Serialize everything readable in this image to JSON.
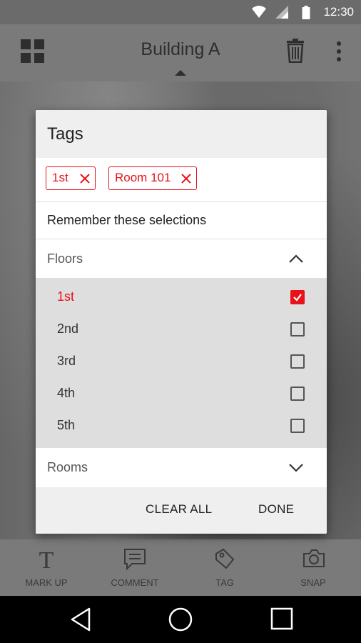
{
  "status_bar": {
    "time": "12:30",
    "icons": [
      "wifi-icon",
      "signal-icon",
      "battery-icon"
    ]
  },
  "app_bar": {
    "title": "Building A",
    "icons": [
      "grid-icon",
      "trash-icon",
      "more-icon"
    ]
  },
  "toolbar": {
    "items": [
      {
        "label": "MARK UP",
        "icon": "text-icon"
      },
      {
        "label": "COMMENT",
        "icon": "comment-icon"
      },
      {
        "label": "TAG",
        "icon": "tag-icon"
      },
      {
        "label": "SNAP",
        "icon": "camera-icon"
      }
    ]
  },
  "dialog": {
    "title": "Tags",
    "chips": [
      {
        "label": "1st"
      },
      {
        "label": "Room 101"
      }
    ],
    "remember_label": "Remember these selections",
    "floors": {
      "header": "Floors",
      "expanded": true,
      "items": [
        {
          "label": "1st",
          "checked": true
        },
        {
          "label": "2nd",
          "checked": false
        },
        {
          "label": "3rd",
          "checked": false
        },
        {
          "label": "4th",
          "checked": false
        },
        {
          "label": "5th",
          "checked": false
        }
      ]
    },
    "rooms": {
      "header": "Rooms",
      "expanded": false
    },
    "actions": {
      "clear_all": "CLEAR ALL",
      "done": "DONE"
    }
  },
  "colors": {
    "accent": "#e8121a",
    "appbar": "#7a7a7a",
    "statusbar": "#6b6b6b",
    "floors_bg": "#dedede"
  }
}
